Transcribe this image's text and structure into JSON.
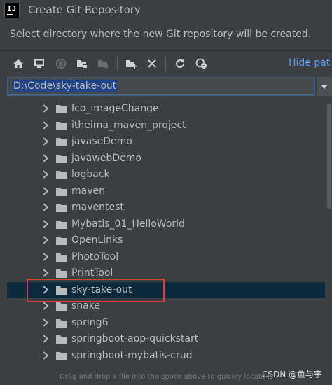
{
  "dialog": {
    "title": "Create Git Repository",
    "description": "Select directory where the new Git repository will be created.",
    "app_logo_text": "IJ"
  },
  "toolbar": {
    "buttons": [
      {
        "icon": "home-icon",
        "enabled": true
      },
      {
        "icon": "desktop-icon",
        "enabled": true
      },
      {
        "icon": "module-icon",
        "enabled": false
      },
      {
        "icon": "project-folder-icon",
        "enabled": true
      },
      {
        "icon": "library-icon",
        "enabled": false
      },
      {
        "icon": "new-folder-icon",
        "enabled": true
      },
      {
        "icon": "delete-icon",
        "enabled": true
      },
      {
        "icon": "refresh-icon",
        "enabled": true
      },
      {
        "icon": "link-icon",
        "enabled": true
      }
    ],
    "hide_path_label": "Hide pat"
  },
  "path": {
    "value": "D:\\Code\\sky-take-out"
  },
  "tree": {
    "items": [
      {
        "label": "Ico_imageChange"
      },
      {
        "label": "itheima_maven_project"
      },
      {
        "label": "javaseDemo"
      },
      {
        "label": "javawebDemo"
      },
      {
        "label": "logback"
      },
      {
        "label": "maven"
      },
      {
        "label": "maventest"
      },
      {
        "label": "Mybatis_01_HelloWorld"
      },
      {
        "label": "OpenLinks"
      },
      {
        "label": "PhotoTool"
      },
      {
        "label": "PrintTool"
      },
      {
        "label": "sky-take-out",
        "selected": true
      },
      {
        "label": "snake"
      },
      {
        "label": "spring6"
      },
      {
        "label": "springboot-aop-quickstart"
      },
      {
        "label": "springboot-mybatis-crud"
      }
    ]
  },
  "footer": {
    "hint": "Drag and drop a file into the space above to quickly locate it",
    "watermark": "CSDN @鱼与宇"
  },
  "colors": {
    "background": "#3c3f41",
    "selection": "#0d293e",
    "accent_link": "#589df6",
    "highlight_box": "#e03b3b"
  }
}
